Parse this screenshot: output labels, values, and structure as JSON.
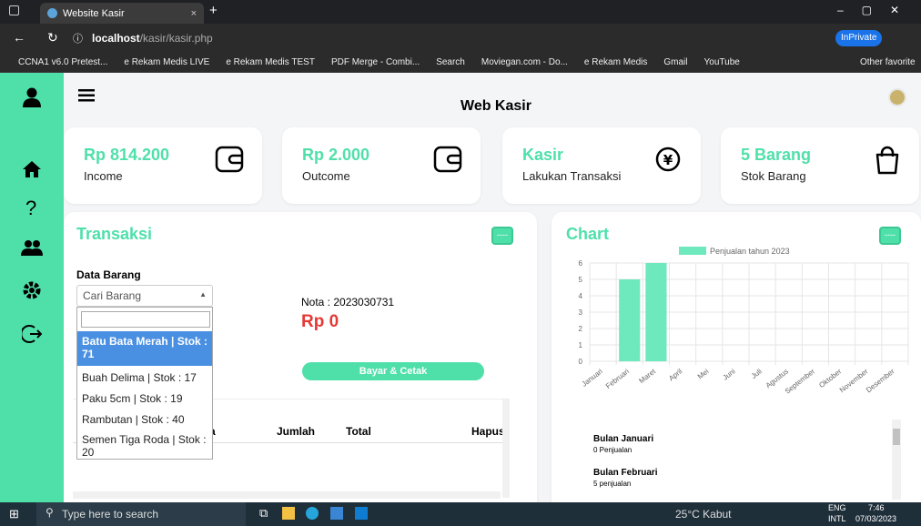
{
  "browser": {
    "tab_title": "Website Kasir",
    "url_host": "localhost",
    "url_path": "/kasir/kasir.php",
    "inprivate": "InPrivate",
    "bookmarks": [
      "CCNA1 v6.0 Pretest...",
      "e Rekam Medis LIVE",
      "e Rekam Medis TEST",
      "PDF Merge - Combi...",
      "Search",
      "Moviegan.com - Do...",
      "e Rekam Medis",
      "Gmail",
      "YouTube"
    ],
    "other_favorites": "Other favorite"
  },
  "header": {
    "title": "Web Kasir"
  },
  "summary": [
    {
      "value": "Rp 814.200",
      "label": "Income"
    },
    {
      "value": "Rp 2.000",
      "label": "Outcome"
    },
    {
      "value": "Kasir",
      "label": "Lakukan Transaksi"
    },
    {
      "value": "5 Barang",
      "label": "Stok Barang"
    }
  ],
  "transaksi": {
    "title": "Transaksi",
    "btn": "----",
    "data_barang_label": "Data Barang",
    "select_placeholder": "Cari Barang",
    "nota": "Nota : 2023030731",
    "total": "Rp 0",
    "pay_button": "Bayar & Cetak",
    "options": [
      "Batu Bata Merah | Stok : 71",
      "Buah Delima | Stok : 17",
      "Paku 5cm | Stok : 19",
      "Rambutan | Stok : 40",
      "Semen Tiga Roda | Stok : 20"
    ],
    "columns": [
      "a",
      "Jumlah",
      "Total",
      "Hapus"
    ]
  },
  "chart": {
    "title": "Chart",
    "btn": "----",
    "monthly": [
      {
        "month": "Bulan Januari",
        "note": "0 Penjualan"
      },
      {
        "month": "Bulan Februari",
        "note": "5 penjualan"
      }
    ]
  },
  "chart_data": {
    "type": "bar",
    "legend": "Penjualan tahun 2023",
    "categories": [
      "Januari",
      "Februari",
      "Maret",
      "April",
      "Mei",
      "Juni",
      "Juli",
      "Agustus",
      "September",
      "Oktober",
      "November",
      "Desember"
    ],
    "values": [
      0,
      5,
      6,
      0,
      0,
      0,
      0,
      0,
      0,
      0,
      0,
      0
    ],
    "ylim": [
      0,
      6
    ],
    "yticks": [
      "0",
      "1",
      "2",
      "3",
      "4",
      "5",
      "6"
    ],
    "color": "#6ee8bd"
  },
  "taskbar": {
    "search": "Type here to search",
    "weather": "25°C  Kabut",
    "lang": "ENG",
    "lang2": "INTL",
    "time": "7:46",
    "date": "07/03/2023"
  }
}
